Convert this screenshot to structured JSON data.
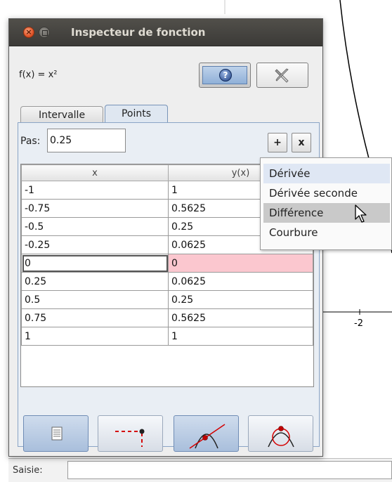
{
  "window": {
    "title": "Inspecteur de fonction",
    "function_label": "f(x) = x²"
  },
  "icons": {
    "close": "close-icon",
    "maximize": "maximize-icon",
    "help": "help-icon",
    "tools": "tools-icon",
    "add": "plus-icon",
    "remove": "x-icon"
  },
  "tabs": [
    {
      "label": "Intervalle",
      "active": false
    },
    {
      "label": "Points",
      "active": true
    }
  ],
  "points_tab": {
    "step_label": "Pas:",
    "step_value": "0.25",
    "add_label": "+",
    "remove_label": "x",
    "columns": [
      "x",
      "y(x)"
    ],
    "rows": [
      {
        "x": "-1",
        "y": "1"
      },
      {
        "x": "-0.75",
        "y": "0.5625"
      },
      {
        "x": "-0.5",
        "y": "0.25"
      },
      {
        "x": "-0.25",
        "y": "0.0625"
      },
      {
        "x": "0",
        "y": "0",
        "selected": true
      },
      {
        "x": "0.25",
        "y": "0.0625"
      },
      {
        "x": "0.5",
        "y": "0.25"
      },
      {
        "x": "0.75",
        "y": "0.5625"
      },
      {
        "x": "1",
        "y": "1"
      }
    ]
  },
  "popup_menu": {
    "items": [
      "Dérivée",
      "Dérivée seconde",
      "Différence",
      "Courbure"
    ],
    "hovered": "Différence"
  },
  "graph": {
    "axis_tick_label": "-2"
  },
  "input_bar": {
    "label": "Saisie:"
  },
  "colors": {
    "selected_row_y": "#fbc7cf",
    "menu_hover": "#c9c9c9",
    "active_tab": "#dfe7f1",
    "curve": "#000000",
    "accent_red": "#d40000"
  }
}
